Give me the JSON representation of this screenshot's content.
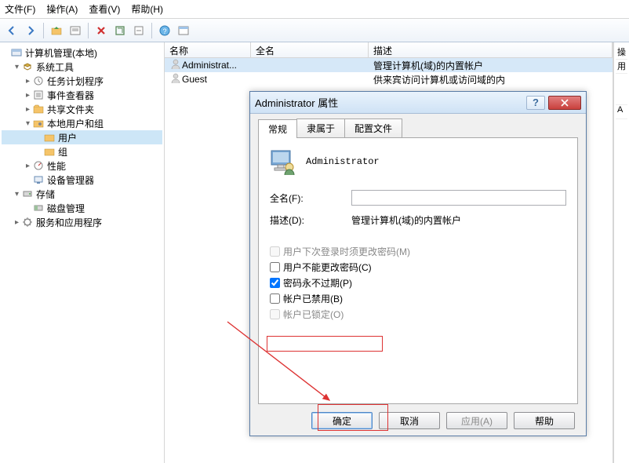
{
  "menu": {
    "file": "文件(F)",
    "action": "操作(A)",
    "view": "查看(V)",
    "help": "帮助(H)"
  },
  "tree": {
    "root": "计算机管理(本地)",
    "systools": "系统工具",
    "tasksched": "任务计划程序",
    "eventviewer": "事件查看器",
    "sharedfolders": "共享文件夹",
    "localusers": "本地用户和组",
    "users": "用户",
    "groups": "组",
    "perf": "性能",
    "devmgr": "设备管理器",
    "storage": "存储",
    "diskmgmt": "磁盘管理",
    "services": "服务和应用程序"
  },
  "list": {
    "head": {
      "name": "名称",
      "fullname": "全名",
      "desc": "描述"
    },
    "rows": [
      {
        "name": "Administrat...",
        "fullname": "",
        "desc": "管理计算机(域)的内置帐户"
      },
      {
        "name": "Guest",
        "fullname": "",
        "desc": "供来宾访问计算机或访问域的内"
      }
    ]
  },
  "actions": {
    "a0": "操",
    "a1": "用",
    "a2": "A"
  },
  "dialog": {
    "title": "Administrator 属性",
    "tabs": {
      "general": "常规",
      "memberof": "隶属于",
      "profile": "配置文件"
    },
    "username": "Administrator",
    "fullname_label": "全名(F):",
    "fullname_value": "",
    "desc_label": "描述(D):",
    "desc_value": "管理计算机(域)的内置帐户",
    "chk_mustchange": "用户下次登录时须更改密码(M)",
    "chk_cannotchange": "用户不能更改密码(C)",
    "chk_neverexpire": "密码永不过期(P)",
    "chk_disabled": "帐户已禁用(B)",
    "chk_locked": "帐户已锁定(O)",
    "btn_ok": "确定",
    "btn_cancel": "取消",
    "btn_apply": "应用(A)",
    "btn_help": "帮助"
  }
}
